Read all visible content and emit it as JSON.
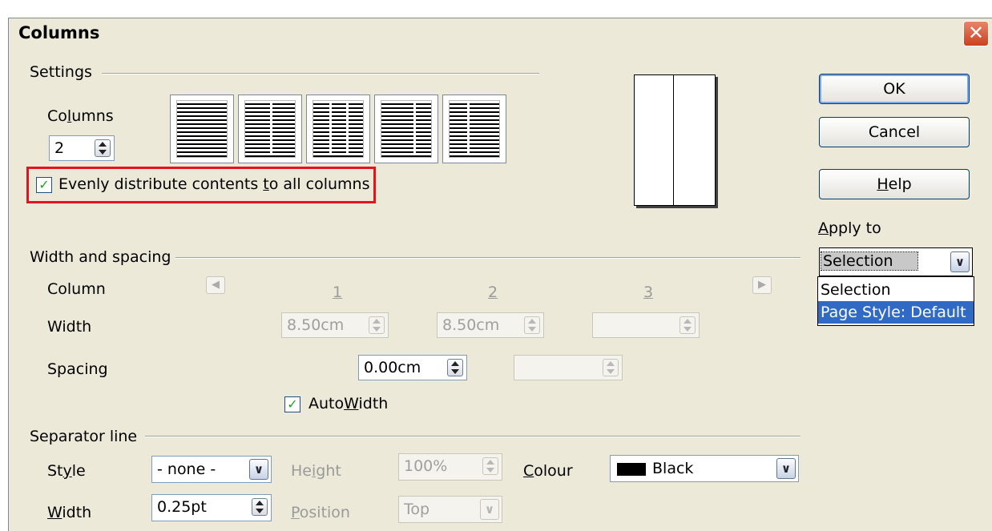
{
  "window": {
    "title": "Columns",
    "close_label": "✕"
  },
  "settings": {
    "section_label": "Settings",
    "columns_label_pre": "Co",
    "columns_label_ul": "l",
    "columns_label_post": "umns",
    "columns_value": "2",
    "evenly_checked": "✓",
    "evenly_pre": "Evenly distribute contents ",
    "evenly_ul": "t",
    "evenly_post": "o all columns"
  },
  "buttons": {
    "ok": "OK",
    "cancel": "Cancel",
    "help_ul": "H",
    "help_post": "elp"
  },
  "apply_to": {
    "label_ul": "A",
    "label_post": "pply to",
    "selected": "Selection",
    "options": [
      "Selection",
      "Page Style: Default"
    ]
  },
  "width_spacing": {
    "section_label": "Width and spacing",
    "column_label": "Column",
    "width_label": "Width",
    "spacing_label": "Spacing",
    "col_numbers": [
      "1",
      "2",
      "3"
    ],
    "widths": [
      "8.50cm",
      "8.50cm",
      ""
    ],
    "spacings": [
      "0.00cm",
      ""
    ],
    "autowidth_checked": "✓",
    "autowidth_pre": "Auto",
    "autowidth_ul": "W",
    "autowidth_post": "idth"
  },
  "separator": {
    "section_label": "Separator line",
    "style_pre": "St",
    "style_ul": "y",
    "style_post": "le",
    "style_value": "- none -",
    "height_pre": "He",
    "height_ul": "i",
    "height_post": "ght",
    "height_value": "100%",
    "colour_ul": "C",
    "colour_post": "olour",
    "colour_value": "Black",
    "width_ul": "W",
    "width_post": "idth",
    "width_value": "0.25pt",
    "position_ul": "P",
    "position_post": "osition",
    "position_value": "Top"
  }
}
